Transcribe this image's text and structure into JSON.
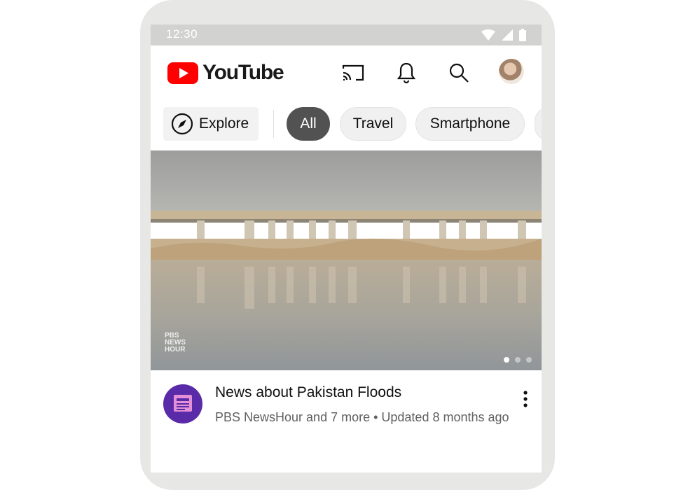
{
  "status_bar": {
    "time": "12:30"
  },
  "app": {
    "logo_text": "YouTube",
    "brand_color": "#ff0000"
  },
  "top_icons": [
    "cast-icon",
    "bell-icon",
    "search-icon",
    "avatar"
  ],
  "chips": {
    "explore_label": "Explore",
    "items": [
      {
        "label": "All",
        "active": true
      },
      {
        "label": "Travel",
        "active": false
      },
      {
        "label": "Smartphone",
        "active": false
      }
    ]
  },
  "thumbnail": {
    "watermark_lines": [
      "PBS",
      "NEWS",
      "HOUR"
    ],
    "carousel_dots": 3,
    "active_dot": 0
  },
  "card": {
    "title": "News about Pakistan Floods",
    "subtitle": "PBS NewsHour and 7 more • Updated 8 months ago"
  }
}
